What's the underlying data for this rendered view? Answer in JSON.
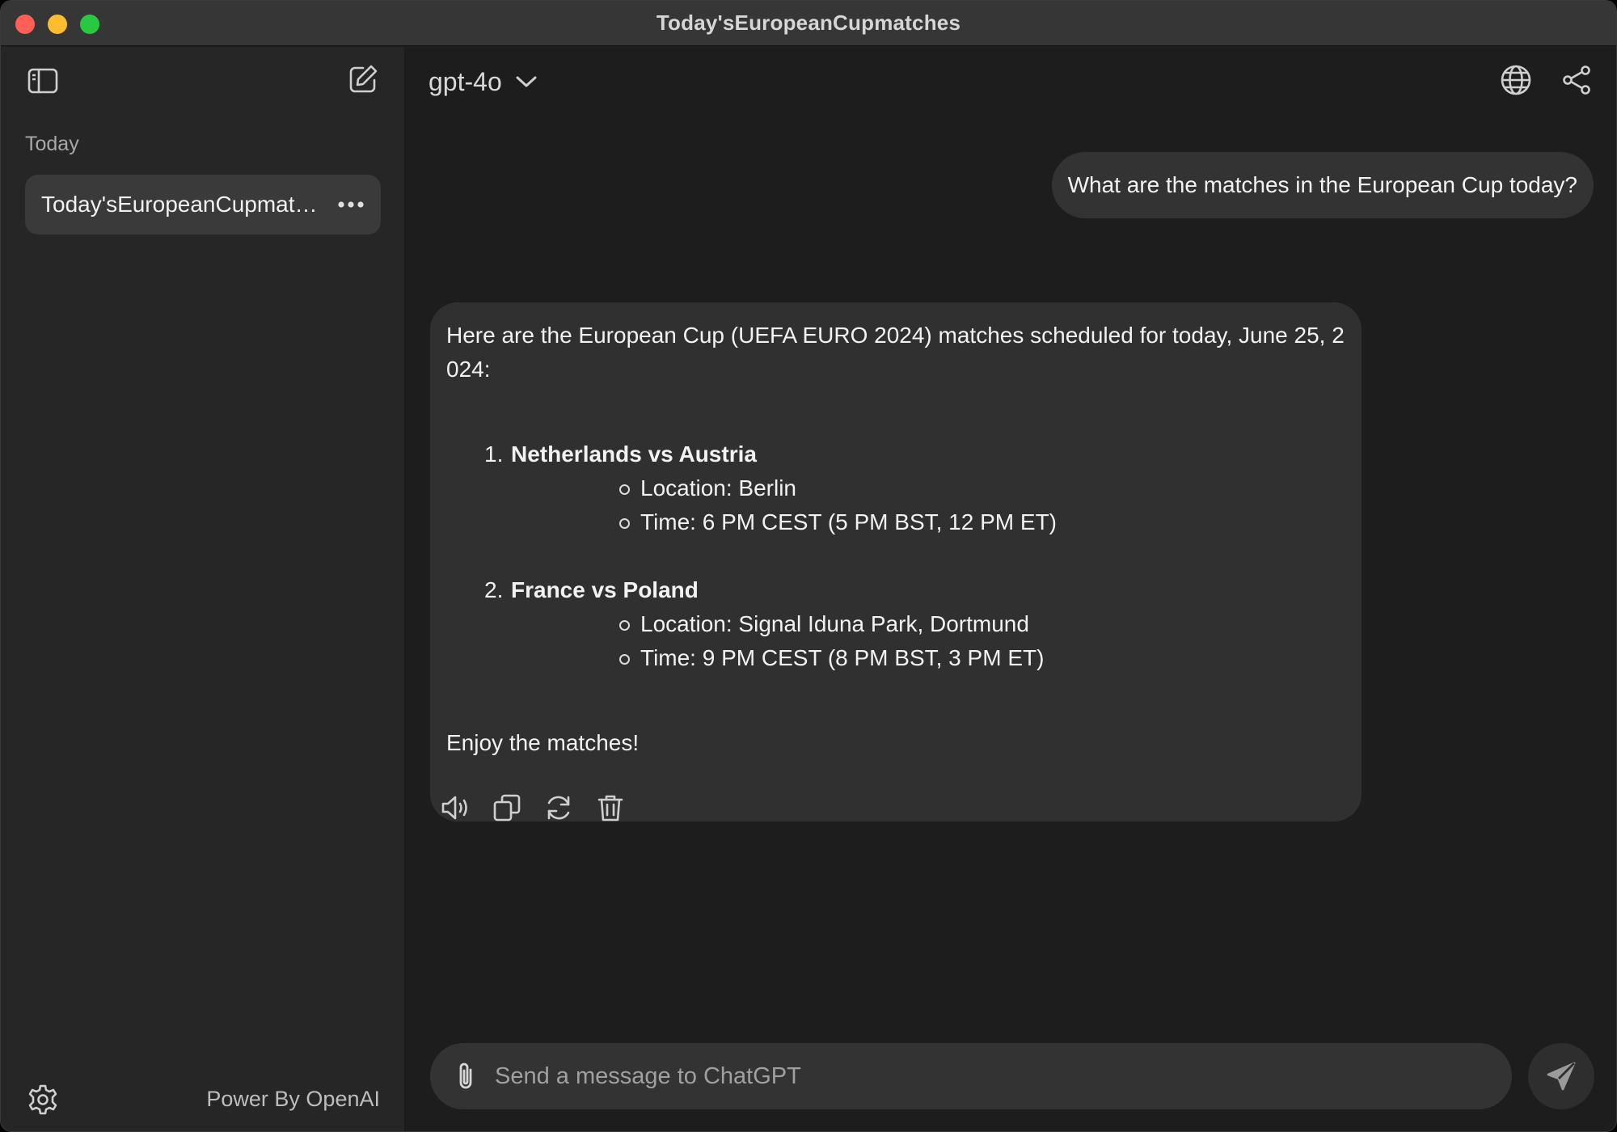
{
  "window": {
    "title": "Today'sEuropeanCupmatches"
  },
  "sidebar": {
    "section_label": "Today",
    "chats": [
      {
        "label": "Today'sEuropeanCupmatches"
      }
    ],
    "footer_text": "Power By OpenAI",
    "icons": [
      "sidebar-toggle-icon",
      "new-chat-icon",
      "more-icon",
      "gear-icon"
    ]
  },
  "header": {
    "model": "gpt-4o",
    "icons": [
      "chevron-down-icon",
      "globe-icon",
      "share-icon"
    ]
  },
  "conversation": {
    "user_message": "What are the matches in the European Cup today?",
    "assistant": {
      "intro": "Here are the European Cup (UEFA EURO 2024) matches scheduled for today, June 25, 2024:",
      "matches": [
        {
          "number": "1.",
          "title": "Netherlands vs Austria",
          "location": "Location: Berlin",
          "time": "Time: 6 PM CEST (5 PM BST, 12 PM ET)"
        },
        {
          "number": "2.",
          "title": "France vs Poland",
          "location": "Location: Signal Iduna Park, Dortmund",
          "time": "Time: 9 PM CEST (8 PM BST, 3 PM ET)"
        }
      ],
      "outro": "Enjoy the matches!"
    },
    "action_icons": [
      "speaker-icon",
      "copy-icon",
      "regenerate-icon",
      "trash-icon"
    ]
  },
  "composer": {
    "placeholder": "Send a message to ChatGPT",
    "value": "",
    "icons": [
      "paperclip-icon",
      "send-icon"
    ]
  },
  "colors": {
    "window_bg": "#1e1e1e",
    "sidebar_bg": "#262626",
    "bubble_bg": "#303030",
    "text": "#ececec",
    "close": "#ff5f57",
    "minimize": "#febc2e",
    "maximize": "#28c840"
  }
}
